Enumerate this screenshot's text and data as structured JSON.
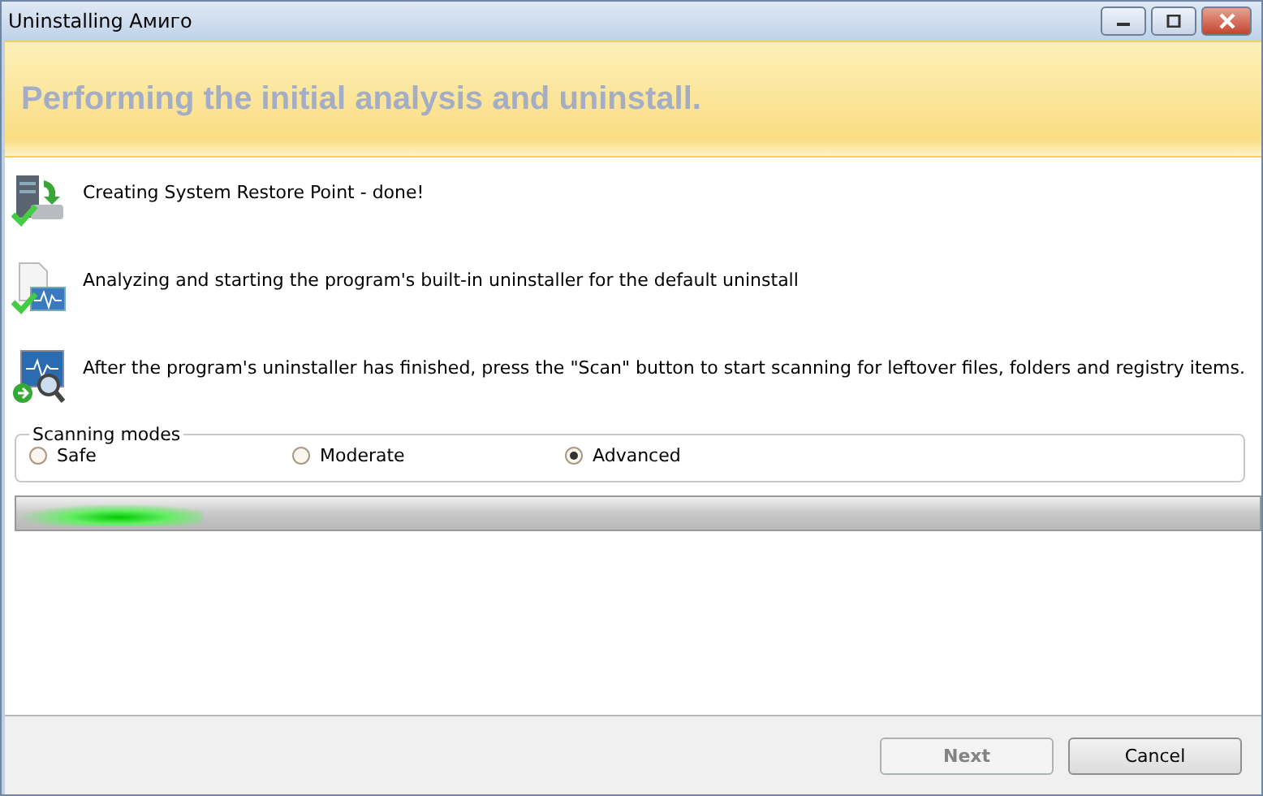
{
  "window": {
    "title": "Uninstalling Амиго"
  },
  "banner": {
    "heading": "Performing the initial analysis and uninstall."
  },
  "steps": [
    {
      "kind": "restore",
      "text": "Creating System Restore Point - done!"
    },
    {
      "kind": "analyze",
      "text": "Analyzing and starting the program's built-in uninstaller for the default uninstall"
    },
    {
      "kind": "scan",
      "text": "After the program's uninstaller has finished, press the \"Scan\" button to start scanning for leftover files, folders and registry items."
    }
  ],
  "scanning_modes": {
    "legend": "Scanning modes",
    "options": [
      {
        "label": "Safe",
        "selected": false
      },
      {
        "label": "Moderate",
        "selected": false
      },
      {
        "label": "Advanced",
        "selected": true
      }
    ]
  },
  "progress": {
    "level": 0.15
  },
  "buttons": [
    {
      "label": "Next",
      "disabled": true
    },
    {
      "label": "Cancel",
      "disabled": false
    }
  ]
}
